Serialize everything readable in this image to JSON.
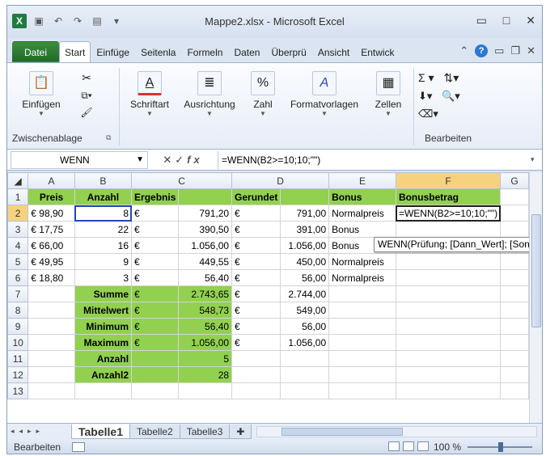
{
  "window": {
    "title": "Mappe2.xlsx - Microsoft Excel",
    "qat": [
      "save-icon",
      "undo-icon",
      "redo-icon",
      "open-icon"
    ]
  },
  "tabs": [
    "Datei",
    "Start",
    "Einfüge",
    "Seitenla",
    "Formeln",
    "Daten",
    "Überprü",
    "Ansicht",
    "Entwick"
  ],
  "ribbon": {
    "groups": [
      {
        "label": "Einfügen",
        "name": "Zwischenablage"
      },
      {
        "label": "Schriftart"
      },
      {
        "label": "Ausrichtung"
      },
      {
        "label": "Zahl"
      },
      {
        "label": "Formatvorlagen"
      },
      {
        "label": "Zellen"
      },
      {
        "label": "Bearbeiten",
        "name": "Bearbeiten"
      }
    ]
  },
  "formula_bar": {
    "name_box": "WENN",
    "formula": "=WENN(B2>=10;10;\"\")"
  },
  "columns": [
    "A",
    "B",
    "C",
    "D",
    "E",
    "F",
    "G"
  ],
  "rows": [
    [
      "Preis",
      "Anzahl",
      "Ergebnis",
      "",
      "Gerundet",
      "",
      "Bonus",
      "Bonusbetrag"
    ],
    [
      "€ 98,90",
      "8",
      "€",
      "791,20",
      "€",
      "791,00",
      "Normalpreis",
      "=WENN(B2>=10;10;\"\")"
    ],
    [
      "€ 17,75",
      "22",
      "€",
      "390,50",
      "€",
      "391,00",
      "Bonus",
      ""
    ],
    [
      "€ 66,00",
      "16",
      "€",
      "1.056,00",
      "€",
      "1.056,00",
      "Bonus",
      ""
    ],
    [
      "€ 49,95",
      "9",
      "€",
      "449,55",
      "€",
      "450,00",
      "Normalpreis",
      ""
    ],
    [
      "€ 18,80",
      "3",
      "€",
      "56,40",
      "€",
      "56,00",
      "Normalpreis",
      ""
    ],
    [
      "",
      "Summe",
      "€",
      "2.743,65",
      "€",
      "2.744,00",
      "",
      ""
    ],
    [
      "",
      "Mittelwert",
      "€",
      "548,73",
      "€",
      "549,00",
      "",
      ""
    ],
    [
      "",
      "Minimum",
      "€",
      "56,40",
      "€",
      "56,00",
      "",
      ""
    ],
    [
      "",
      "Maximum",
      "€",
      "1.056,00",
      "€",
      "1.056,00",
      "",
      ""
    ],
    [
      "",
      "Anzahl",
      "",
      "5",
      "",
      "",
      "",
      ""
    ],
    [
      "",
      "Anzahl2",
      "",
      "28",
      "",
      "",
      "",
      ""
    ],
    [
      "",
      "",
      "",
      "",
      "",
      "",
      "",
      ""
    ]
  ],
  "tooltip": "WENN(Prüfung; [Dann_Wert]; [Sonst_Wert])",
  "sheets": [
    "Tabelle1",
    "Tabelle2",
    "Tabelle3"
  ],
  "status": {
    "mode": "Bearbeiten",
    "zoom": "100 %"
  }
}
